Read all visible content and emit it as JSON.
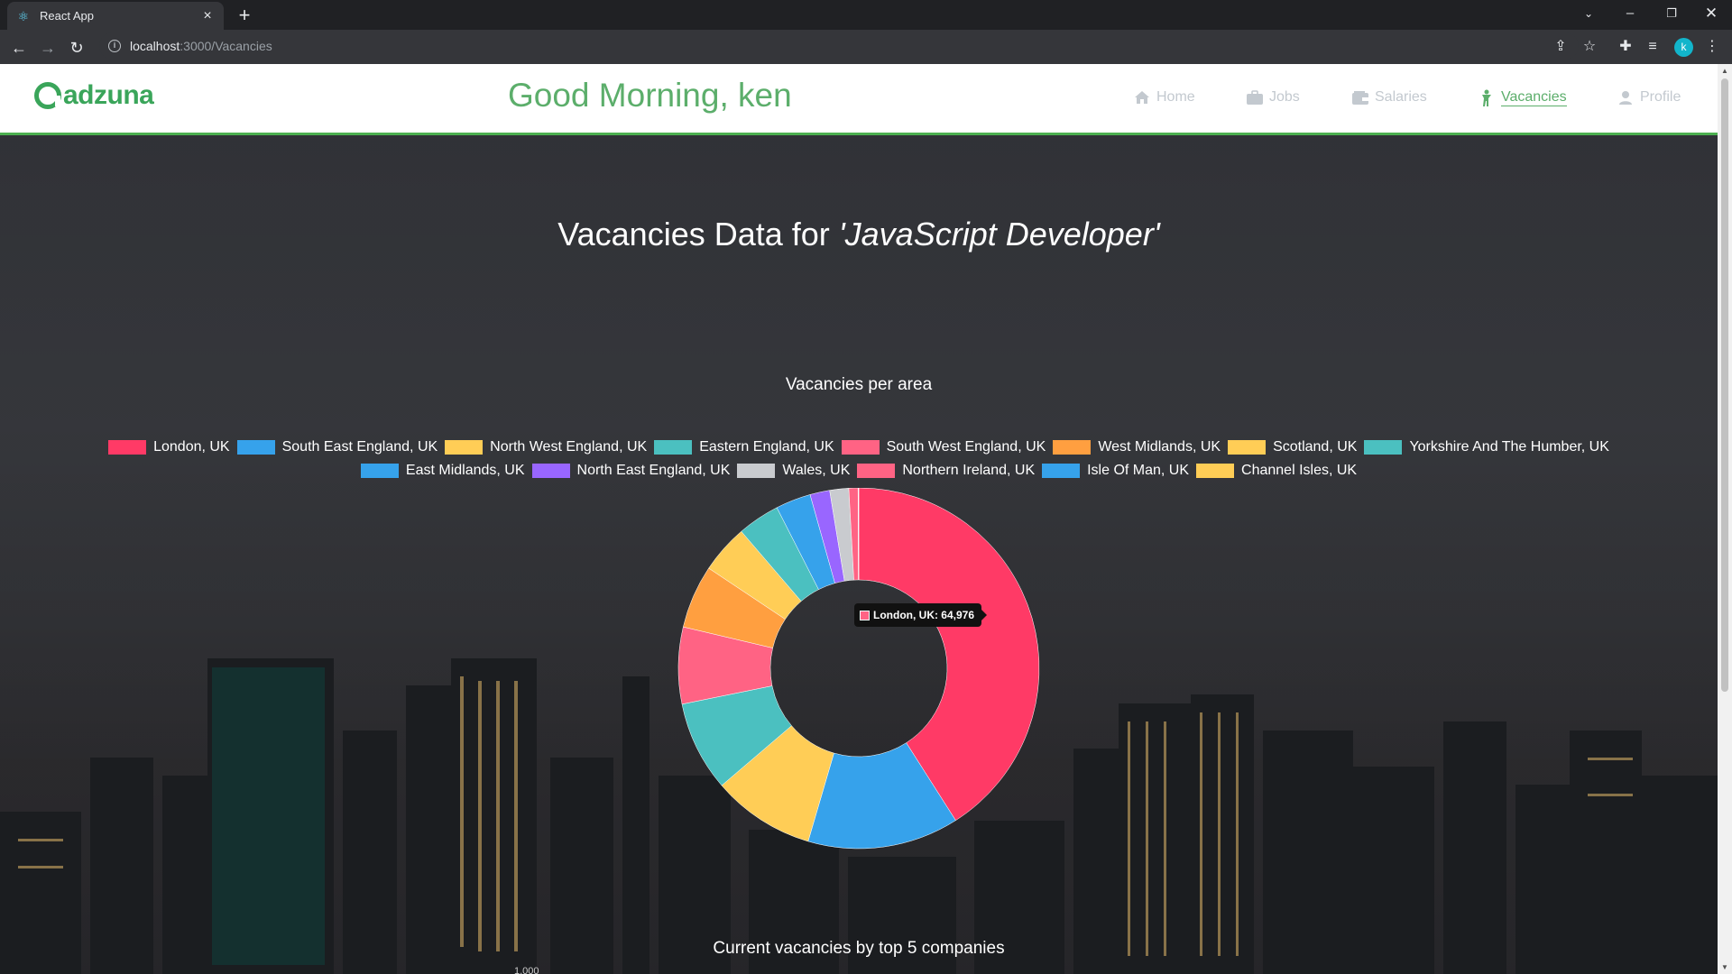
{
  "browser": {
    "tab_title": "React App",
    "url_host": "localhost",
    "url_path": ":3000/Vacancies",
    "profile_initial": "k"
  },
  "header": {
    "logo_text": "adzuna",
    "greeting": "Good Morning, ken",
    "nav": [
      {
        "label": "Home",
        "icon": "home-icon"
      },
      {
        "label": "Jobs",
        "icon": "briefcase-icon"
      },
      {
        "label": "Salaries",
        "icon": "wallet-icon"
      },
      {
        "label": "Vacancies",
        "icon": "person-icon",
        "active": true
      },
      {
        "label": "Profile",
        "icon": "user-icon"
      }
    ]
  },
  "page": {
    "heading_prefix": "Vacancies Data for ",
    "heading_query": "'JavaScript Developer'",
    "bar_chart_title": "Current vacancies by top 5 companies",
    "partial_tick": "1,000"
  },
  "colors": {
    "accent": "#5cae6b",
    "pink": "#ff6384",
    "blue": "#36a2eb",
    "yellow": "#ffcd56",
    "teal": "#4bc0c0",
    "orange": "#ff9f40",
    "purple": "#9966ff",
    "grey": "#c9cbcf"
  },
  "tooltip": {
    "text": "London, UK: 64,976"
  },
  "chart_data": {
    "type": "pie",
    "title": "Vacancies per area",
    "legend_position": "top",
    "labels": [
      "London, UK",
      "South East England, UK",
      "North West England, UK",
      "Eastern England, UK",
      "South West England, UK",
      "West Midlands, UK",
      "Scotland, UK",
      "Yorkshire And The Humber, UK",
      "East Midlands, UK",
      "North East England, UK",
      "Wales, UK",
      "Northern Ireland, UK",
      "Isle Of Man, UK",
      "Channel Isles, UK"
    ],
    "values": [
      64976,
      21500,
      14600,
      12800,
      10900,
      9000,
      6900,
      6000,
      5000,
      2800,
      2700,
      1300,
      60,
      40
    ],
    "colors": [
      "#ff3a66",
      "#36a2eb",
      "#ffcd56",
      "#4bc0c0",
      "#ff6384",
      "#ff9f40",
      "#ffcd56",
      "#4bc0c0",
      "#36a2eb",
      "#9966ff",
      "#c9cbcf",
      "#ff6384",
      "#36a2eb",
      "#ffcd56"
    ]
  }
}
